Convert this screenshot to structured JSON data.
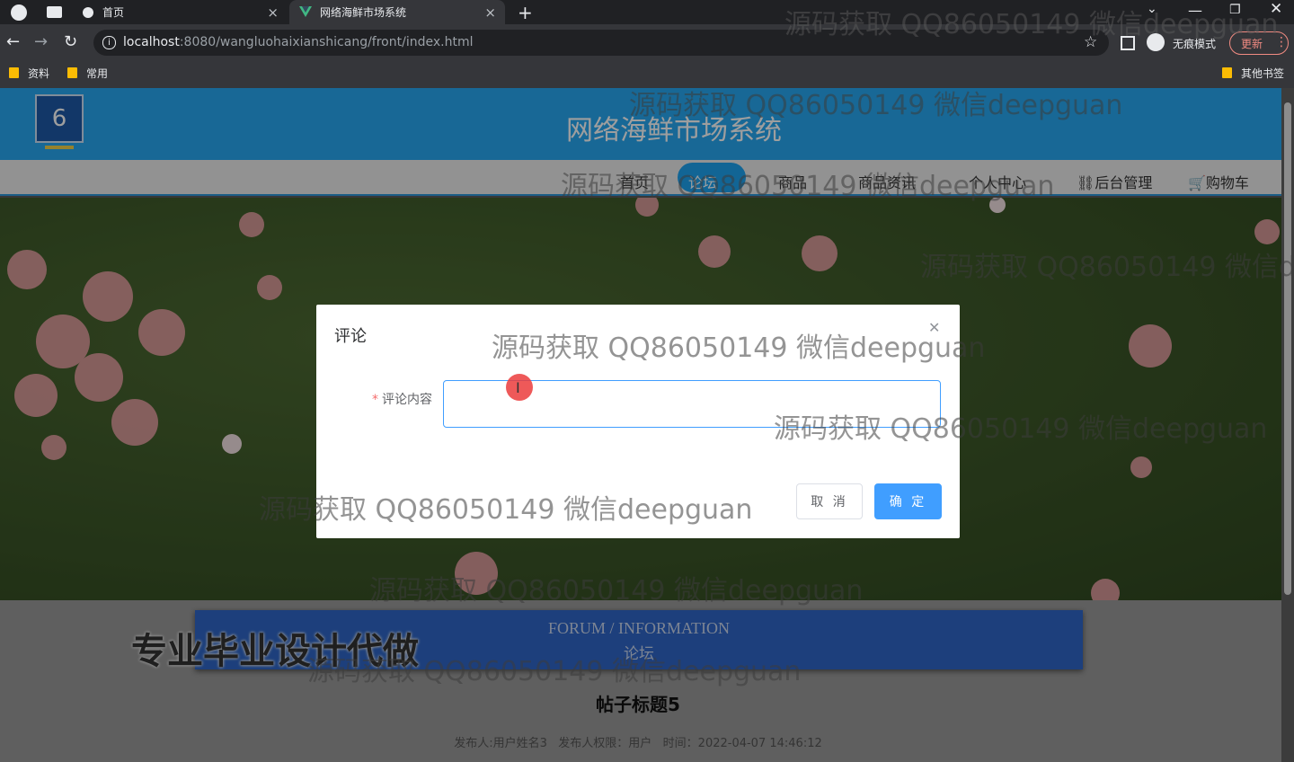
{
  "browser": {
    "tabs": [
      {
        "label": "首页",
        "active": false
      },
      {
        "label": "网络海鲜市场系统",
        "active": true
      }
    ],
    "url_host": "localhost",
    "url_rest": ":8080/wangluohaixianshicang/front/index.html",
    "profile_label": "无痕模式",
    "update_label": "更新",
    "bookmarks": [
      "资料",
      "常用"
    ],
    "other_bookmarks": "其他书签"
  },
  "site": {
    "title": "网络海鲜市场系统",
    "nav": [
      "首页",
      "论坛",
      "商品",
      "商品资讯",
      "个人中心",
      "后台管理",
      "购物车"
    ],
    "active_nav": "论坛",
    "banner_en": "FORUM / INFORMATION",
    "banner_cn": "论坛",
    "post_title": "帖子标题5",
    "post_meta": "发布人:用户姓名3   发布人权限：用户   时间：2022-04-07 14:46:12",
    "overlay_text": "专业毕业设计代做"
  },
  "modal": {
    "title": "评论",
    "field_label": "评论内容",
    "field_value": "",
    "cancel_label": "取 消",
    "confirm_label": "确 定"
  },
  "watermark": "源码获取 QQ86050149 微信deepguan",
  "colors": {
    "header_blue": "#28a9f3",
    "primary": "#409eff",
    "banner_blue": "#2f67c8"
  }
}
